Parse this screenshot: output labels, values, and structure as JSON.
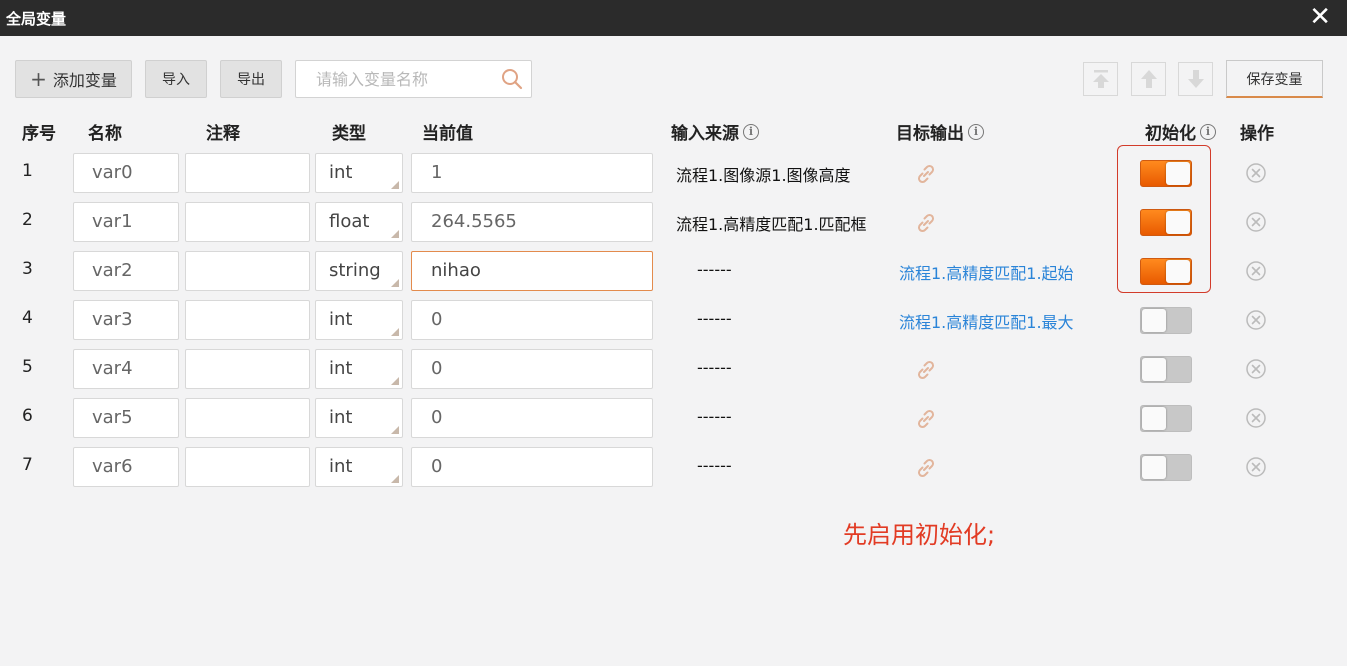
{
  "window": {
    "title": "全局变量",
    "close_glyph": "✕"
  },
  "toolbar": {
    "add_label": "添加变量",
    "import_label": "导入",
    "export_label": "导出",
    "search_placeholder": "请输入变量名称",
    "save_label": "保存变量",
    "icons": [
      "move-to-top-icon",
      "move-up-icon",
      "move-down-icon"
    ]
  },
  "headers": {
    "seq": "序号",
    "name": "名称",
    "note": "注释",
    "type": "类型",
    "value": "当前值",
    "source": "输入来源",
    "target": "目标输出",
    "init": "初始化",
    "action": "操作",
    "info_glyph": "i"
  },
  "rows": [
    {
      "seq": "1",
      "name": "var0",
      "note": "",
      "type": "int",
      "value": "1",
      "source": "流程1.图像源1.图像高度",
      "target": "",
      "init": true
    },
    {
      "seq": "2",
      "name": "var1",
      "note": "",
      "type": "float",
      "value": "264.5565",
      "source": "流程1.高精度匹配1.匹配框",
      "target": "",
      "init": true
    },
    {
      "seq": "3",
      "name": "var2",
      "note": "",
      "type": "string",
      "value": "nihao",
      "source": "------",
      "target": "流程1.高精度匹配1.起始",
      "init": true
    },
    {
      "seq": "4",
      "name": "var3",
      "note": "",
      "type": "int",
      "value": "0",
      "source": "------",
      "target": "流程1.高精度匹配1.最大",
      "init": false
    },
    {
      "seq": "5",
      "name": "var4",
      "note": "",
      "type": "int",
      "value": "0",
      "source": "------",
      "target": "",
      "init": false
    },
    {
      "seq": "6",
      "name": "var5",
      "note": "",
      "type": "int",
      "value": "0",
      "source": "------",
      "target": "",
      "init": false
    },
    {
      "seq": "7",
      "name": "var6",
      "note": "",
      "type": "int",
      "value": "0",
      "source": "------",
      "target": "",
      "init": false
    }
  ],
  "annotation": "先启用初始化;",
  "colors": {
    "toggle_on": "#f2700d",
    "link": "#2a84d8",
    "annotation": "#e23b24",
    "highlight": "#d23b2a"
  }
}
